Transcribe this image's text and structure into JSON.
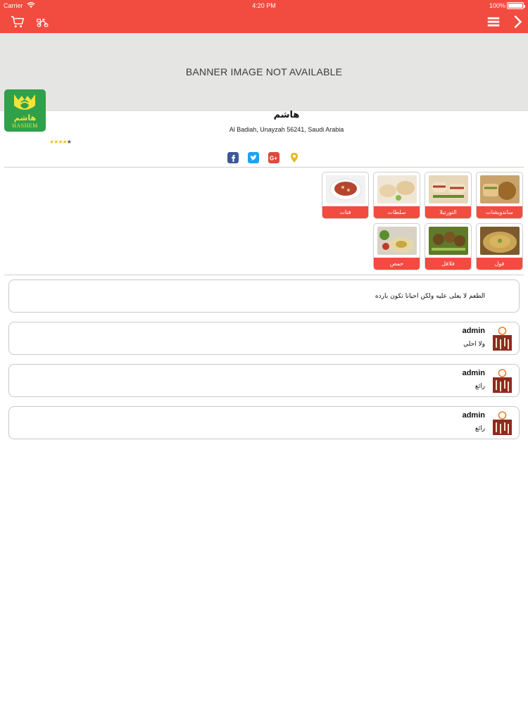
{
  "status_bar": {
    "carrier": "Carrier",
    "time": "4:20 PM",
    "battery": "100%"
  },
  "nav": {
    "cart_icon": "cart-icon",
    "delivery_icon": "delivery-icon",
    "menu_icon": "hamburger-icon",
    "forward_icon": "chevron-right-icon"
  },
  "banner": {
    "text": "BANNER IMAGE NOT AVAILABLE"
  },
  "restaurant": {
    "logo_ar": "هاشم",
    "logo_en": "HASHEM",
    "name": "هاشم",
    "address": "Al Badiah, Unayzah 56241, Saudi Arabia",
    "rating": 4,
    "rating_max": 5
  },
  "social": [
    "facebook-icon",
    "twitter-icon",
    "google-plus-icon",
    "location-pin-icon"
  ],
  "colors": {
    "accent": "#f24b3f",
    "banner_bg": "#e5e5e3",
    "star": "#f1c21b",
    "logo_bg": "#2fa14a"
  },
  "categories": [
    {
      "label": "ساندويشات"
    },
    {
      "label": "التورتيلا"
    },
    {
      "label": "سلطات"
    },
    {
      "label": "فتات"
    },
    {
      "label": "فول"
    },
    {
      "label": "فلافل"
    },
    {
      "label": "حمص"
    }
  ],
  "review": {
    "text": "الطعم لا يعلى عليه ولكن احيانا تكون بارده"
  },
  "comments": [
    {
      "author": "admin",
      "body": "ولا احلي"
    },
    {
      "author": "admin",
      "body": "رائع"
    },
    {
      "author": "admin",
      "body": "رائع"
    }
  ]
}
